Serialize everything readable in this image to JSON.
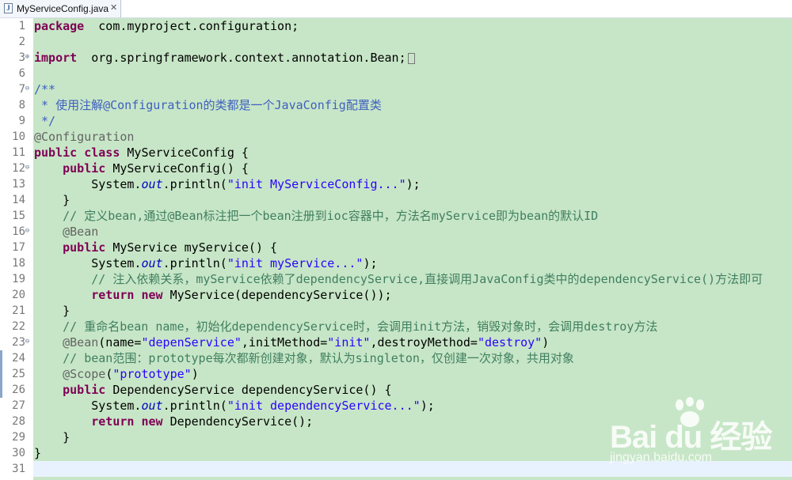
{
  "tab": {
    "filename": "MyServiceConfig.java",
    "icon": "java-file-icon",
    "close": "✕"
  },
  "watermark": {
    "logo": "Bai du 经验",
    "url": "jingyan.baidu.com"
  },
  "lines": [
    {
      "n": "1",
      "segs": [
        [
          "kw",
          "package"
        ],
        [
          "",
          "  com.myproject.configuration;"
        ]
      ]
    },
    {
      "n": "2",
      "segs": []
    },
    {
      "n": "3",
      "fold": "+",
      "segs": [
        [
          "kw",
          "import"
        ],
        [
          "",
          "  org.springframework.context.annotation.Bean;"
        ]
      ],
      "box": true
    },
    {
      "n": "6",
      "segs": []
    },
    {
      "n": "7",
      "fold": "-",
      "segs": [
        [
          "doc",
          "/**"
        ]
      ]
    },
    {
      "n": "8",
      "segs": [
        [
          "doc",
          " * 使用注解@Configuration的类都是一个JavaConfig配置类"
        ]
      ]
    },
    {
      "n": "9",
      "segs": [
        [
          "doc",
          " */"
        ]
      ]
    },
    {
      "n": "10",
      "segs": [
        [
          "ann",
          "@Configuration"
        ]
      ]
    },
    {
      "n": "11",
      "segs": [
        [
          "kw",
          "public class"
        ],
        [
          "",
          " MyServiceConfig {"
        ]
      ]
    },
    {
      "n": "12",
      "fold": "-",
      "segs": [
        [
          "",
          "    "
        ],
        [
          "kw",
          "public"
        ],
        [
          "",
          " MyServiceConfig() {"
        ]
      ]
    },
    {
      "n": "13",
      "segs": [
        [
          "",
          "        System."
        ],
        [
          "st",
          "out"
        ],
        [
          "",
          ".println("
        ],
        [
          "str",
          "\"init MyServiceConfig...\""
        ],
        [
          "",
          ");"
        ]
      ]
    },
    {
      "n": "14",
      "segs": [
        [
          "",
          "    }"
        ]
      ]
    },
    {
      "n": "15",
      "segs": [
        [
          "",
          "    "
        ],
        [
          "cm",
          "// 定义bean,通过@Bean标注把一个bean注册到ioc容器中，方法名myService即为bean的默认ID"
        ]
      ]
    },
    {
      "n": "16",
      "fold": "-",
      "segs": [
        [
          "",
          "    "
        ],
        [
          "ann",
          "@Bean"
        ]
      ]
    },
    {
      "n": "17",
      "segs": [
        [
          "",
          "    "
        ],
        [
          "kw",
          "public"
        ],
        [
          "",
          " MyService myService() {"
        ]
      ]
    },
    {
      "n": "18",
      "segs": [
        [
          "",
          "        System."
        ],
        [
          "st",
          "out"
        ],
        [
          "",
          ".println("
        ],
        [
          "str",
          "\"init myService...\""
        ],
        [
          "",
          ");"
        ]
      ]
    },
    {
      "n": "19",
      "segs": [
        [
          "",
          "        "
        ],
        [
          "cm",
          "// 注入依赖关系，myService依赖了dependencyService,直接调用JavaConfig类中的dependencyService()方法即可"
        ]
      ]
    },
    {
      "n": "20",
      "segs": [
        [
          "",
          "        "
        ],
        [
          "kw",
          "return new"
        ],
        [
          "",
          " MyService(dependencyService());"
        ]
      ]
    },
    {
      "n": "21",
      "segs": [
        [
          "",
          "    }"
        ]
      ]
    },
    {
      "n": "22",
      "segs": [
        [
          "",
          "    "
        ],
        [
          "cm",
          "// 重命名bean name，初始化dependencyService时，会调用init方法，销毁对象时，会调用destroy方法"
        ]
      ]
    },
    {
      "n": "23",
      "fold": "-",
      "segs": [
        [
          "",
          "    "
        ],
        [
          "ann",
          "@Bean"
        ],
        [
          "",
          "(name="
        ],
        [
          "str",
          "\"depenService\""
        ],
        [
          "",
          ",initMethod="
        ],
        [
          "str",
          "\"init\""
        ],
        [
          "",
          ",destroyMethod="
        ],
        [
          "str",
          "\"destroy\""
        ],
        [
          "",
          ")"
        ]
      ]
    },
    {
      "n": "24",
      "segs": [
        [
          "",
          "    "
        ],
        [
          "cm",
          "// bean范围：prototype每次都新创建对象，默认为singleton，仅创建一次对象，共用对象"
        ]
      ]
    },
    {
      "n": "25",
      "segs": [
        [
          "",
          "    "
        ],
        [
          "ann",
          "@Scope"
        ],
        [
          "",
          "("
        ],
        [
          "str",
          "\"prototype\""
        ],
        [
          "",
          ")"
        ]
      ]
    },
    {
      "n": "26",
      "segs": [
        [
          "",
          "    "
        ],
        [
          "kw",
          "public"
        ],
        [
          "",
          " DependencyService dependencyService() {"
        ]
      ]
    },
    {
      "n": "27",
      "segs": [
        [
          "",
          "        System."
        ],
        [
          "st",
          "out"
        ],
        [
          "",
          ".println("
        ],
        [
          "str",
          "\"init dependencyService...\""
        ],
        [
          "",
          ");"
        ]
      ]
    },
    {
      "n": "28",
      "segs": [
        [
          "",
          "        "
        ],
        [
          "kw",
          "return new"
        ],
        [
          "",
          " DependencyService();"
        ]
      ]
    },
    {
      "n": "29",
      "segs": [
        [
          "",
          "    }"
        ]
      ]
    },
    {
      "n": "30",
      "segs": [
        [
          "",
          "}"
        ]
      ]
    },
    {
      "n": "31",
      "segs": [],
      "current": true
    }
  ]
}
